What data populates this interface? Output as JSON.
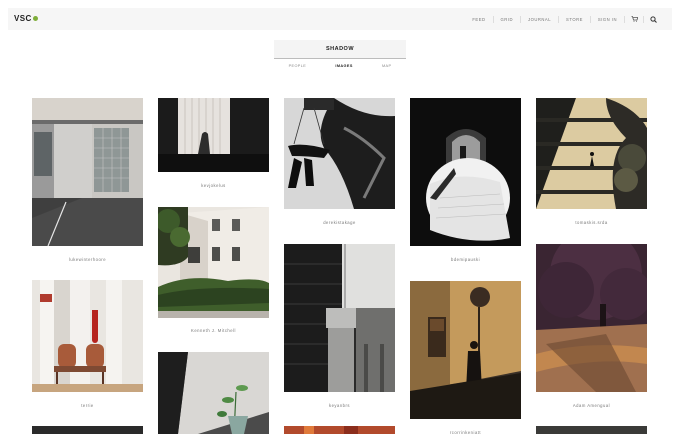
{
  "logo": {
    "text": "VSC",
    "accent": "#7fae3a"
  },
  "nav": {
    "items": [
      "FEED",
      "GRID",
      "JOURNAL",
      "STORE",
      "SIGN IN"
    ],
    "cart_icon": "cart-icon",
    "search_icon": "search-icon"
  },
  "search": {
    "query": "SHADOW",
    "tabs": [
      "PEOPLE",
      "IMAGES",
      "MAP"
    ],
    "active_tab": "IMAGES"
  },
  "captions": {
    "c1": "lukewinterhoore",
    "c2": "kevjokelus",
    "c3": "derekistakage",
    "c4": "bdemipauski",
    "c5": "tomaskis.srda",
    "c6": "Kenneth J. Mitchell",
    "c7": "keyanbrs",
    "c8": "terrie",
    "c9": "rcorrinkeniatt",
    "c10": "Adam Amengual"
  }
}
